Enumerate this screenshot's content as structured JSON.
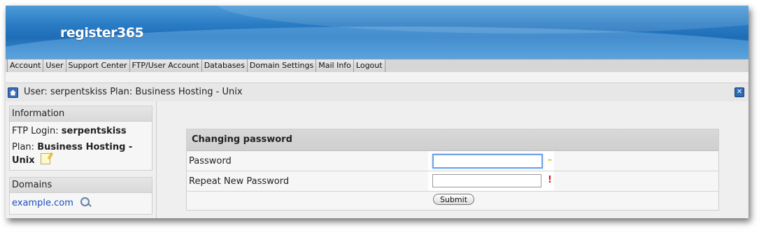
{
  "header": {
    "logo_text": "register365"
  },
  "nav": {
    "items": [
      {
        "label": "Account"
      },
      {
        "label": "User"
      },
      {
        "label": "Support Center"
      },
      {
        "label": "FTP/User Account"
      },
      {
        "label": "Databases"
      },
      {
        "label": "Domain Settings"
      },
      {
        "label": "Mail Info"
      },
      {
        "label": "Logout"
      }
    ]
  },
  "titlebar": {
    "text": "User: serpentskiss Plan: Business Hosting - Unix",
    "home_icon": "home-icon",
    "close_icon": "close-icon"
  },
  "sidebar": {
    "information": {
      "heading": "Information",
      "ftp_login_label": "FTP Login:",
      "ftp_login_value": "serpentskiss",
      "plan_label": "Plan:",
      "plan_value": "Business Hosting - Unix"
    },
    "domains": {
      "heading": "Domains",
      "domain": "example.com"
    }
  },
  "form": {
    "heading": "Changing password",
    "fields": [
      {
        "label": "Password",
        "value": "",
        "indicator": "–"
      },
      {
        "label": "Repeat New Password",
        "value": "",
        "indicator": "!"
      }
    ],
    "submit_label": "Submit"
  },
  "colors": {
    "banner": "#2a7cc4",
    "link": "#1a4fbf",
    "warning": "#d8b800",
    "error": "#d21c1c"
  }
}
